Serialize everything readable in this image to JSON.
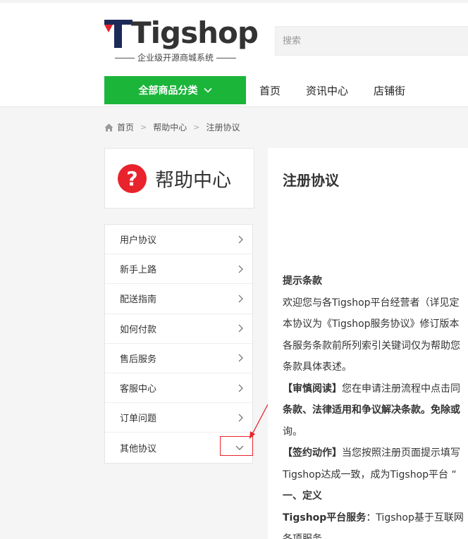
{
  "header": {
    "logo": {
      "brand": "Tigshop",
      "slogan": "企业级开源商城系统"
    },
    "search": {
      "placeholder": "搜索"
    },
    "category_button": "全部商品分类",
    "nav": [
      "首页",
      "资讯中心",
      "店铺街"
    ]
  },
  "breadcrumb": [
    "首页",
    "帮助中心",
    "注册协议"
  ],
  "help_card": {
    "title": "帮助中心"
  },
  "sidebar": {
    "items": [
      "用户协议",
      "新手上路",
      "配送指南",
      "如何付款",
      "售后服务",
      "客服中心",
      "订单问题",
      "其他协议"
    ]
  },
  "content": {
    "title": "注册协议",
    "lines": [
      {
        "text": "提示条款",
        "bold": true
      },
      {
        "text": "欢迎您与各Tigshop平台经营者（详见定"
      },
      {
        "text": "本协议为《Tigshop服务协议》修订版本"
      },
      {
        "text": "各服务条款前所列索引关键词仅为帮助您"
      },
      {
        "text": "条款具体表述。"
      },
      {
        "bold_prefix": "【审慎阅读】",
        "text": "您在申请注册流程中点击同"
      },
      {
        "text": "条款、法律适用和争议解决条款。免除或",
        "bold": true
      },
      {
        "text": "询。"
      },
      {
        "bold_prefix": "【签约动作】",
        "text": "当您按照注册页面提示填写"
      },
      {
        "text": "Tigshop达成一致，成为Tigshop平台 “"
      },
      {
        "text": "一、定义",
        "bold": true
      },
      {
        "bold_prefix": "Tigshop平台服务",
        "text": "：Tigshop基于互联网"
      },
      {
        "text": "各项服务。"
      }
    ]
  },
  "colors": {
    "accent_green": "#1bb53a",
    "help_red": "#e8232c",
    "logo_navy": "#1d2a57",
    "logo_red": "#e8232c"
  }
}
